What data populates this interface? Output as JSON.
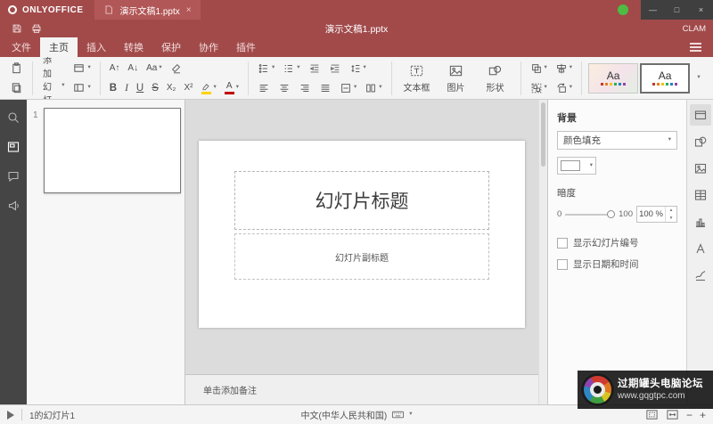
{
  "window": {
    "logo": "ONLYOFFICE",
    "tab_title": "演示文稿1.pptx",
    "tab_close": "×",
    "minimize": "—",
    "maximize": "□",
    "close": "×"
  },
  "quickbar": {
    "title": "演示文稿1.pptx",
    "user": "CLAM"
  },
  "menu": {
    "tabs": [
      "文件",
      "主页",
      "插入",
      "转换",
      "保护",
      "协作",
      "插件"
    ]
  },
  "ribbon": {
    "add_slide": "添加幻灯片",
    "font": {
      "bold": "B",
      "italic": "I",
      "underline": "U",
      "strike": "S",
      "sub": "X₂",
      "sup": "X²",
      "inc": "A↑",
      "dec": "A↓",
      "case": "Aa",
      "color": "A"
    },
    "insert": {
      "textbox": "文本框",
      "image": "图片",
      "shape": "形状"
    },
    "theme_sample": "Aa"
  },
  "thumbnails": {
    "slide_number": "1"
  },
  "slide": {
    "title": "幻灯片标题",
    "subtitle": "幻灯片副标题",
    "notes": "单击添加备注"
  },
  "panel": {
    "background": "背景",
    "fill": "颜色填充",
    "opacity": "暗度",
    "min": "0",
    "max": "100",
    "value": "100 %",
    "show_slide_number": "显示幻灯片编号",
    "show_date_time": "显示日期和时间"
  },
  "status": {
    "slide_info": "1的幻灯片1",
    "language": "中文(中华人民共和国)"
  },
  "watermark": {
    "title": "过期罐头电脑论坛",
    "url": "www.gqgtpc.com"
  },
  "ui": {
    "chev": "▾",
    "up": "▴",
    "down": "▾",
    "plus": "+",
    "zoom_in": "+",
    "zoom_out": "−"
  },
  "colors": {
    "brand_red": "#a24a4a",
    "tab_red": "#b25757",
    "canvas_gray": "#dcdcdc",
    "green_indicator": "#4fbb43"
  }
}
